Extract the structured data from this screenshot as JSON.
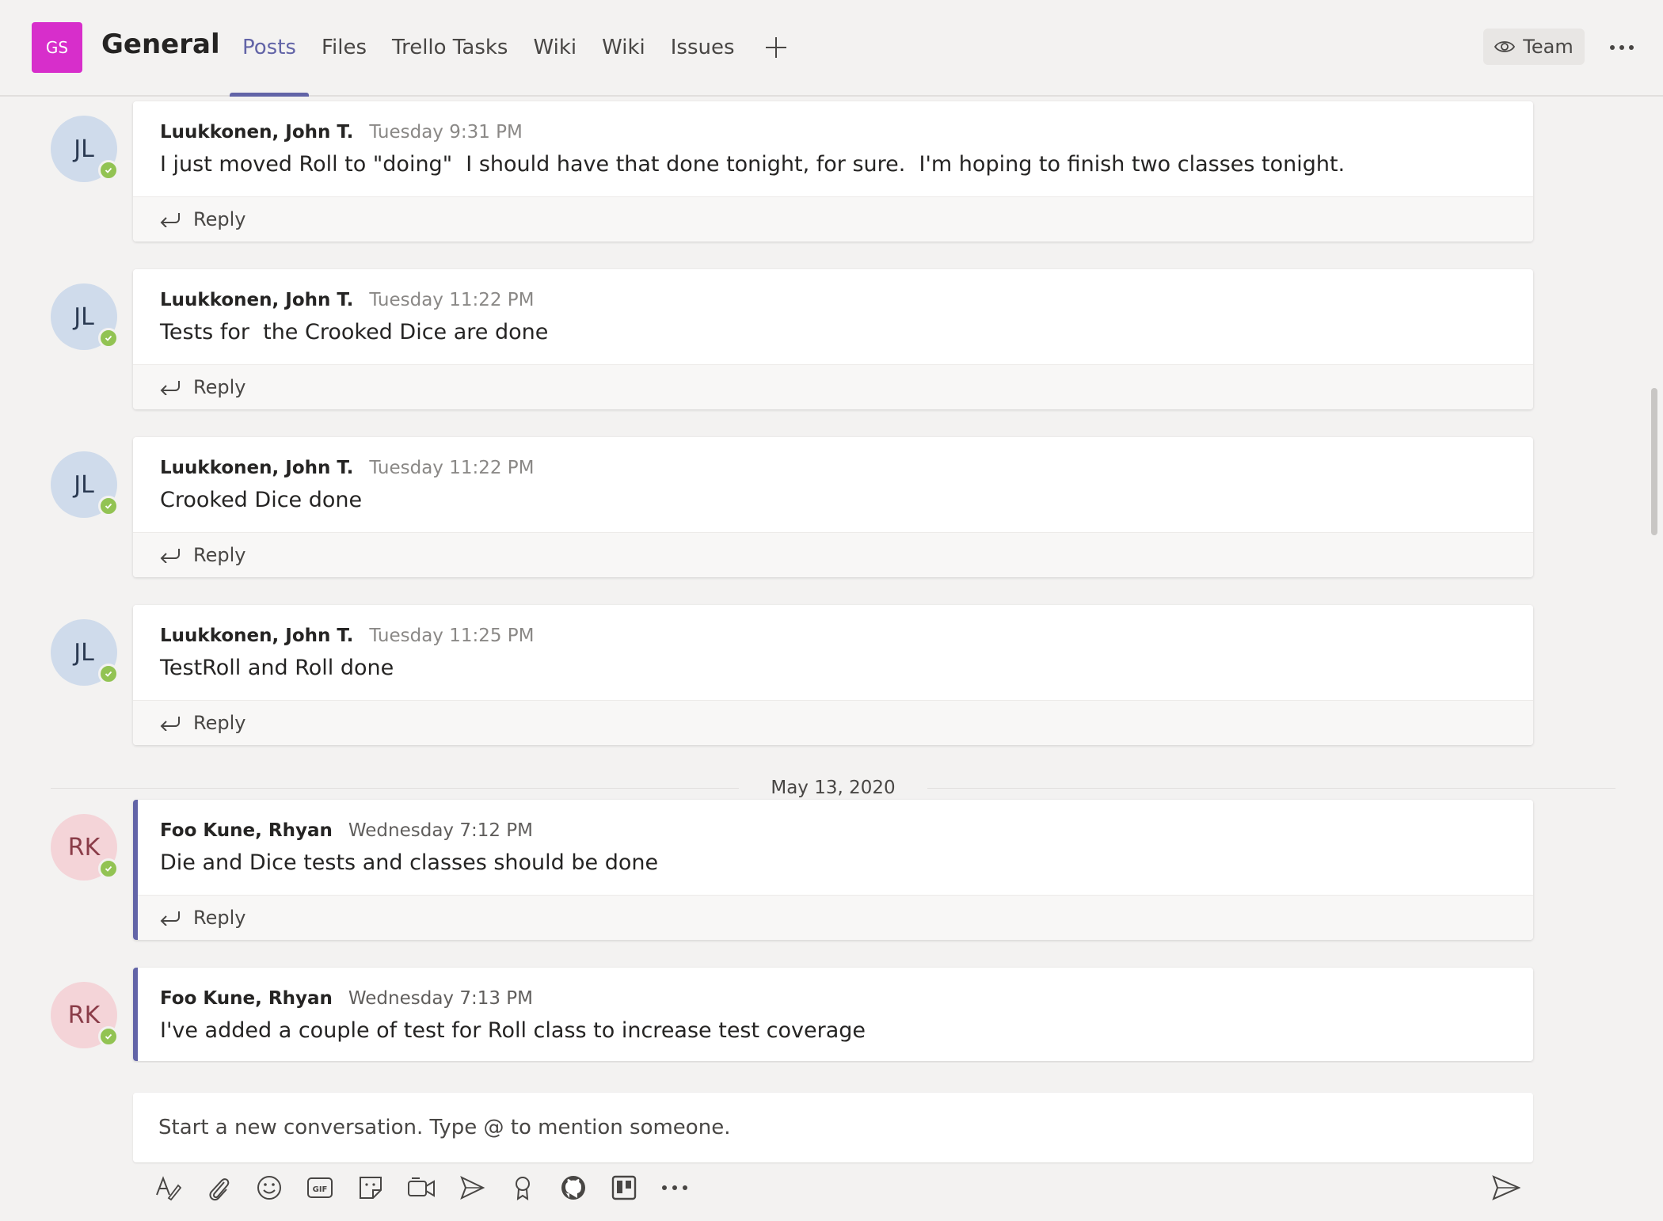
{
  "header": {
    "team_initials": "GS",
    "channel_name": "General",
    "tabs": [
      {
        "label": "Posts",
        "active": true
      },
      {
        "label": "Files"
      },
      {
        "label": "Trello Tasks"
      },
      {
        "label": "Wiki"
      },
      {
        "label": "Wiki"
      },
      {
        "label": "Issues"
      }
    ],
    "team_button_label": "Team",
    "more_icon": "ellipsis-icon"
  },
  "colors": {
    "accent": "#6264a7",
    "team_avatar": "#d72ecb",
    "presence": "#92c353"
  },
  "posts": [
    {
      "initials": "JL",
      "author": "Luukkonen, John T.",
      "time": "Tuesday 9:31 PM",
      "body": "I just moved Roll to \"doing\"  I should have that done tonight, for sure.  I'm hoping to finish two classes tonight.",
      "reply_label": "Reply"
    },
    {
      "initials": "JL",
      "author": "Luukkonen, John T.",
      "time": "Tuesday 11:22 PM",
      "body": "Tests for  the Crooked Dice are done",
      "reply_label": "Reply"
    },
    {
      "initials": "JL",
      "author": "Luukkonen, John T.",
      "time": "Tuesday 11:22 PM",
      "body": "Crooked Dice done",
      "reply_label": "Reply"
    },
    {
      "initials": "JL",
      "author": "Luukkonen, John T.",
      "time": "Tuesday 11:25 PM",
      "body": "TestRoll and Roll done",
      "reply_label": "Reply"
    },
    {
      "initials": "RK",
      "author": "Foo Kune, Rhyan",
      "time": "Wednesday 7:12 PM",
      "body": "Die and Dice tests and classes should be done",
      "reply_label": "Reply"
    },
    {
      "initials": "RK",
      "author": "Foo Kune, Rhyan",
      "time": "Wednesday 7:13 PM",
      "body": "I've added a couple of test for Roll class to increase test coverage"
    }
  ],
  "date_divider": "May 13, 2020",
  "compose": {
    "placeholder": "Start a new conversation. Type @ to mention someone."
  },
  "toolbar_icons": [
    "format-icon",
    "attach-icon",
    "emoji-icon",
    "gif-icon",
    "sticker-icon",
    "meet-now-icon",
    "stream-icon",
    "praise-icon",
    "github-icon",
    "trello-icon",
    "more-options-icon"
  ],
  "send_icon": "send-icon"
}
